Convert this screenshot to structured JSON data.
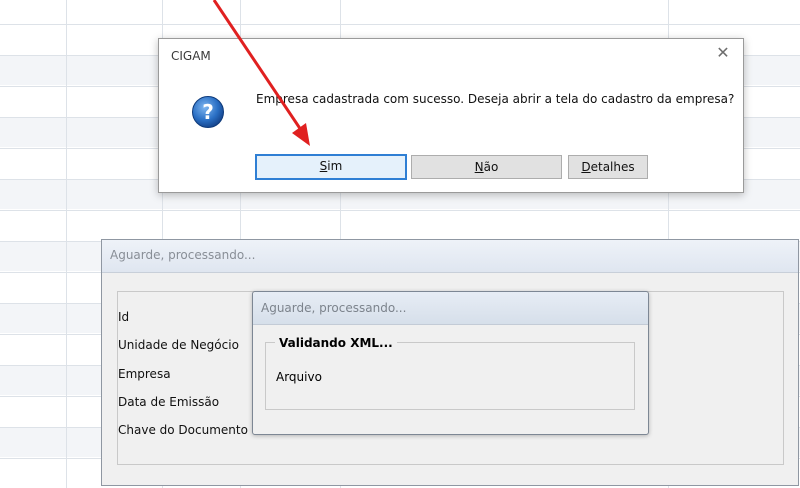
{
  "message_box": {
    "title": "CIGAM",
    "close_glyph": "✕",
    "message": "Empresa cadastrada com sucesso. Deseja abrir a tela do cadastro da empresa?",
    "icon": "question-icon",
    "buttons": {
      "sim": {
        "mnemonic": "S",
        "rest": "im"
      },
      "nao": {
        "mnemonic": "N",
        "rest": "ão"
      },
      "detalhes": {
        "mnemonic": "D",
        "rest": "etalhes"
      }
    }
  },
  "processing_back": {
    "title": "Aguarde, processando...",
    "fields": [
      "Id",
      "Unidade de Negócio",
      "Empresa",
      "Data de Emissão",
      "Chave do Documento"
    ]
  },
  "processing_front": {
    "title": "Aguarde, processando...",
    "group_title": "Validando XML...",
    "file_label": "Arquivo"
  },
  "colors": {
    "annotation_arrow": "#e02020",
    "default_button_border": "#2f7fd4"
  }
}
